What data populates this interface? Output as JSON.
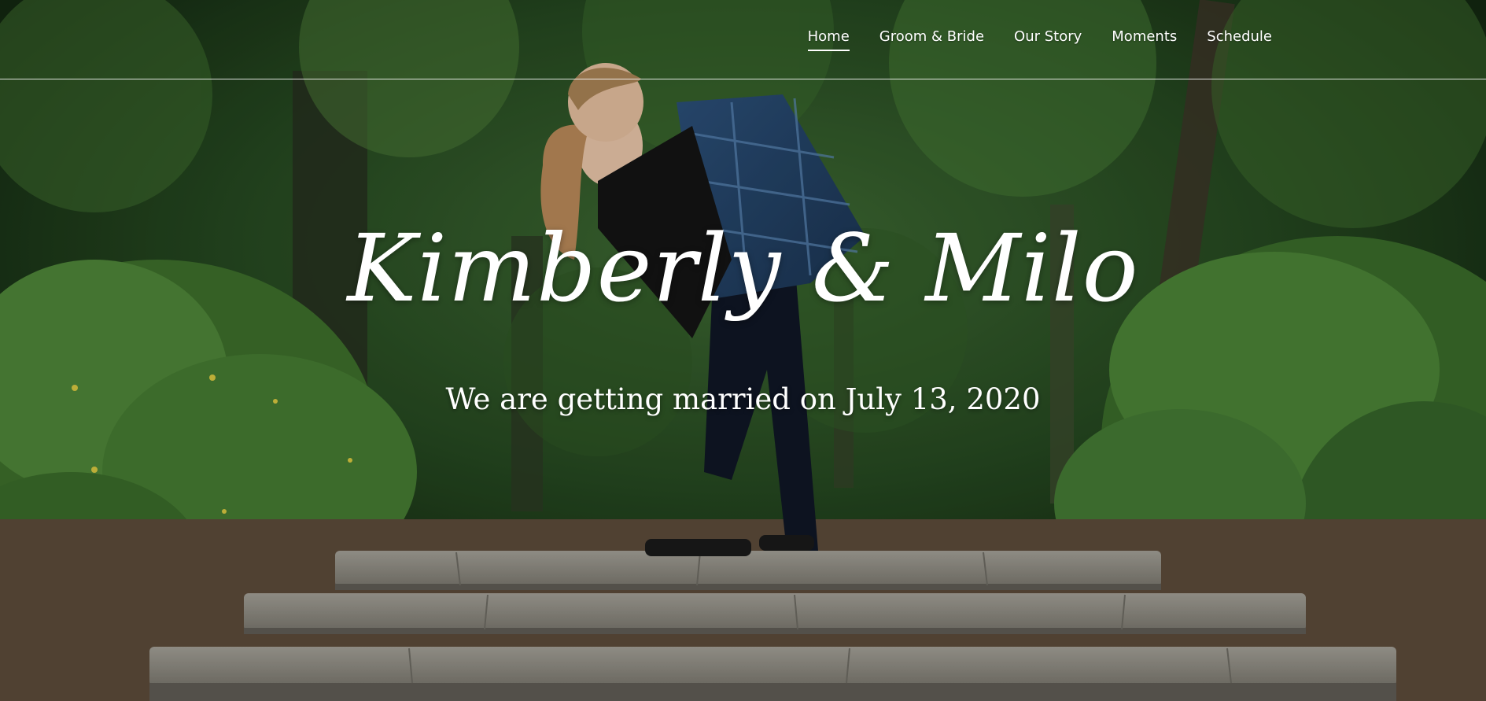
{
  "nav": {
    "items": [
      {
        "label": "Home",
        "active": true
      },
      {
        "label": "Groom & Bride",
        "active": false
      },
      {
        "label": "Our Story",
        "active": false
      },
      {
        "label": "Moments",
        "active": false
      },
      {
        "label": "Schedule",
        "active": false
      }
    ]
  },
  "hero": {
    "title": "Kimberly & Milo",
    "subtitle": "We are getting married on July 13, 2020",
    "photo": "couple-kissing-on-stone-steps-photo"
  },
  "colors": {
    "text": "#ffffff",
    "foliage": "#2f5a26",
    "stone": "#8d8a80"
  }
}
